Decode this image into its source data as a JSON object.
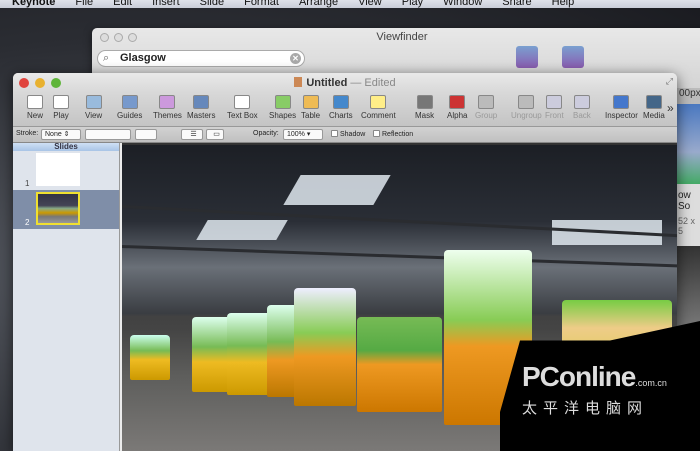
{
  "menubar": {
    "items": [
      "Keynote",
      "File",
      "Edit",
      "Insert",
      "Slide",
      "Format",
      "Arrange",
      "View",
      "Play",
      "Window",
      "Share",
      "Help"
    ]
  },
  "viewfinder": {
    "title": "Viewfinder",
    "search_value": "Glasgow",
    "right_text": "00px",
    "side_caption1": "ow So",
    "side_caption2": "52 x 5"
  },
  "keynote": {
    "title": "Untitled",
    "status": "— Edited",
    "toolbar": [
      "New",
      "Play",
      "View",
      "Guides",
      "Themes",
      "Masters",
      "Text Box",
      "Shapes",
      "Table",
      "Charts",
      "Comment",
      "Mask",
      "Alpha",
      "Group",
      "Ungroup",
      "Front",
      "Back",
      "Inspector",
      "Media"
    ],
    "more": "»",
    "format": {
      "stroke_label": "Stroke:",
      "stroke_value": "None",
      "opacity_label": "Opacity:",
      "opacity_value": "100%",
      "shadow": "Shadow",
      "reflection": "Reflection"
    },
    "slides": {
      "header": "Slides",
      "items": [
        {
          "number": "1"
        },
        {
          "number": "2"
        }
      ]
    }
  },
  "watermark": {
    "brand": "PConline",
    "domain": ".com.cn",
    "chinese": "太平洋电脑网"
  }
}
